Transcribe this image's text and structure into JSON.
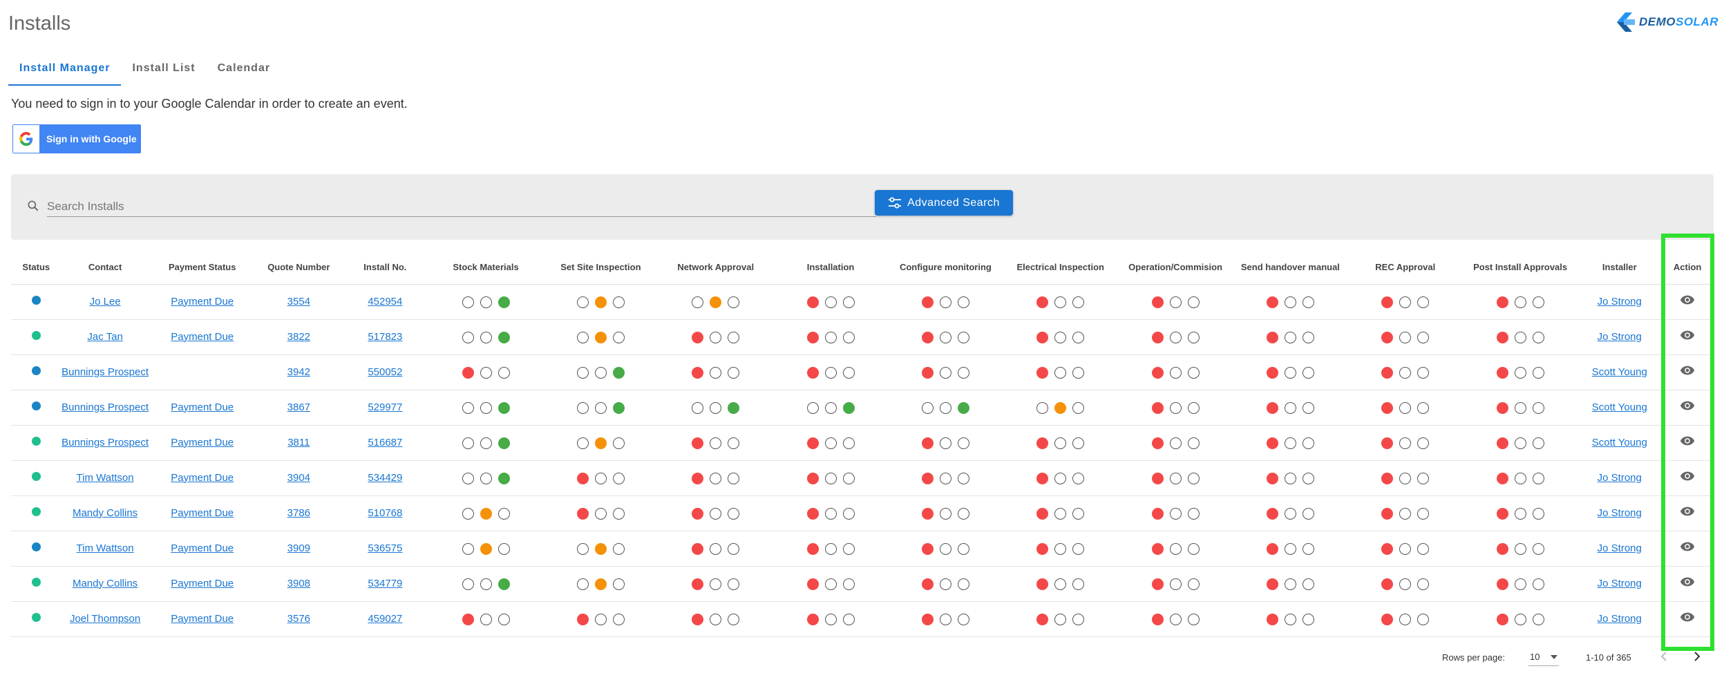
{
  "page": {
    "title": "Installs"
  },
  "logo": {
    "demo": "DEMO",
    "solar": "SOLAR"
  },
  "tabs": [
    {
      "label": "Install Manager",
      "active": true
    },
    {
      "label": "Install List",
      "active": false
    },
    {
      "label": "Calendar",
      "active": false
    }
  ],
  "gcal": {
    "message": "You need to sign in to your Google Calendar in order to create an event.",
    "button_label": "Sign in with Google"
  },
  "search": {
    "placeholder": "Search Installs",
    "advanced_label": "Advanced Search"
  },
  "table": {
    "headers": [
      "Status",
      "Contact",
      "Payment Status",
      "Quote Number",
      "Install No.",
      "Stock Materials",
      "Set Site Inspection",
      "Network Approval",
      "Installation",
      "Configure monitoring",
      "Electrical Inspection",
      "Operation/Commision",
      "Send handover manual",
      "REC Approval",
      "Post Install Approvals",
      "Installer",
      "Action"
    ],
    "status_colors": {
      "blue": "#1a85c4",
      "teal": "#1fbf8f"
    },
    "rows": [
      {
        "status": "blue",
        "contact": "Jo Lee",
        "payment": "Payment Due",
        "quote": "3554",
        "install_no": "452954",
        "stages": [
          [
            "o",
            "o",
            "g"
          ],
          [
            "o",
            "y",
            "o"
          ],
          [
            "o",
            "y",
            "o"
          ],
          [
            "r",
            "o",
            "o"
          ],
          [
            "r",
            "o",
            "o"
          ],
          [
            "r",
            "o",
            "o"
          ],
          [
            "r",
            "o",
            "o"
          ],
          [
            "r",
            "o",
            "o"
          ],
          [
            "r",
            "o",
            "o"
          ],
          [
            "r",
            "o",
            "o"
          ]
        ],
        "installer": "Jo Strong"
      },
      {
        "status": "teal",
        "contact": "Jac Tan",
        "payment": "Payment Due",
        "quote": "3822",
        "install_no": "517823",
        "stages": [
          [
            "o",
            "o",
            "g"
          ],
          [
            "o",
            "y",
            "o"
          ],
          [
            "r",
            "o",
            "o"
          ],
          [
            "r",
            "o",
            "o"
          ],
          [
            "r",
            "o",
            "o"
          ],
          [
            "r",
            "o",
            "o"
          ],
          [
            "r",
            "o",
            "o"
          ],
          [
            "r",
            "o",
            "o"
          ],
          [
            "r",
            "o",
            "o"
          ],
          [
            "r",
            "o",
            "o"
          ]
        ],
        "installer": "Jo Strong"
      },
      {
        "status": "blue",
        "contact": "Bunnings Prospect",
        "payment": "",
        "quote": "3942",
        "install_no": "550052",
        "stages": [
          [
            "r",
            "o",
            "o"
          ],
          [
            "o",
            "o",
            "g"
          ],
          [
            "r",
            "o",
            "o"
          ],
          [
            "r",
            "o",
            "o"
          ],
          [
            "r",
            "o",
            "o"
          ],
          [
            "r",
            "o",
            "o"
          ],
          [
            "r",
            "o",
            "o"
          ],
          [
            "r",
            "o",
            "o"
          ],
          [
            "r",
            "o",
            "o"
          ],
          [
            "r",
            "o",
            "o"
          ]
        ],
        "installer": "Scott Young"
      },
      {
        "status": "blue",
        "contact": "Bunnings Prospect",
        "payment": "Payment Due",
        "quote": "3867",
        "install_no": "529977",
        "stages": [
          [
            "o",
            "o",
            "g"
          ],
          [
            "o",
            "o",
            "g"
          ],
          [
            "o",
            "o",
            "g"
          ],
          [
            "o",
            "o",
            "g"
          ],
          [
            "o",
            "o",
            "g"
          ],
          [
            "o",
            "y",
            "o"
          ],
          [
            "r",
            "o",
            "o"
          ],
          [
            "r",
            "o",
            "o"
          ],
          [
            "r",
            "o",
            "o"
          ],
          [
            "r",
            "o",
            "o"
          ]
        ],
        "installer": "Scott Young"
      },
      {
        "status": "teal",
        "contact": "Bunnings Prospect",
        "payment": "Payment Due",
        "quote": "3811",
        "install_no": "516687",
        "stages": [
          [
            "o",
            "o",
            "g"
          ],
          [
            "o",
            "y",
            "o"
          ],
          [
            "r",
            "o",
            "o"
          ],
          [
            "r",
            "o",
            "o"
          ],
          [
            "r",
            "o",
            "o"
          ],
          [
            "r",
            "o",
            "o"
          ],
          [
            "r",
            "o",
            "o"
          ],
          [
            "r",
            "o",
            "o"
          ],
          [
            "r",
            "o",
            "o"
          ],
          [
            "r",
            "o",
            "o"
          ]
        ],
        "installer": "Scott Young"
      },
      {
        "status": "teal",
        "contact": "Tim Wattson",
        "payment": "Payment Due",
        "quote": "3904",
        "install_no": "534429",
        "stages": [
          [
            "o",
            "o",
            "g"
          ],
          [
            "r",
            "o",
            "o"
          ],
          [
            "r",
            "o",
            "o"
          ],
          [
            "r",
            "o",
            "o"
          ],
          [
            "r",
            "o",
            "o"
          ],
          [
            "r",
            "o",
            "o"
          ],
          [
            "r",
            "o",
            "o"
          ],
          [
            "r",
            "o",
            "o"
          ],
          [
            "r",
            "o",
            "o"
          ],
          [
            "r",
            "o",
            "o"
          ]
        ],
        "installer": "Jo Strong"
      },
      {
        "status": "teal",
        "contact": "Mandy Collins",
        "payment": "Payment Due",
        "quote": "3786",
        "install_no": "510768",
        "stages": [
          [
            "o",
            "y",
            "o"
          ],
          [
            "r",
            "o",
            "o"
          ],
          [
            "r",
            "o",
            "o"
          ],
          [
            "r",
            "o",
            "o"
          ],
          [
            "r",
            "o",
            "o"
          ],
          [
            "r",
            "o",
            "o"
          ],
          [
            "r",
            "o",
            "o"
          ],
          [
            "r",
            "o",
            "o"
          ],
          [
            "r",
            "o",
            "o"
          ],
          [
            "r",
            "o",
            "o"
          ]
        ],
        "installer": "Jo Strong"
      },
      {
        "status": "blue",
        "contact": "Tim Wattson",
        "payment": "Payment Due",
        "quote": "3909",
        "install_no": "536575",
        "stages": [
          [
            "o",
            "y",
            "o"
          ],
          [
            "o",
            "y",
            "o"
          ],
          [
            "r",
            "o",
            "o"
          ],
          [
            "r",
            "o",
            "o"
          ],
          [
            "r",
            "o",
            "o"
          ],
          [
            "r",
            "o",
            "o"
          ],
          [
            "r",
            "o",
            "o"
          ],
          [
            "r",
            "o",
            "o"
          ],
          [
            "r",
            "o",
            "o"
          ],
          [
            "r",
            "o",
            "o"
          ]
        ],
        "installer": "Jo Strong"
      },
      {
        "status": "teal",
        "contact": "Mandy Collins",
        "payment": "Payment Due",
        "quote": "3908",
        "install_no": "534779",
        "stages": [
          [
            "o",
            "o",
            "g"
          ],
          [
            "o",
            "y",
            "o"
          ],
          [
            "r",
            "o",
            "o"
          ],
          [
            "r",
            "o",
            "o"
          ],
          [
            "r",
            "o",
            "o"
          ],
          [
            "r",
            "o",
            "o"
          ],
          [
            "r",
            "o",
            "o"
          ],
          [
            "r",
            "o",
            "o"
          ],
          [
            "r",
            "o",
            "o"
          ],
          [
            "r",
            "o",
            "o"
          ]
        ],
        "installer": "Jo Strong"
      },
      {
        "status": "teal",
        "contact": "Joel Thompson",
        "payment": "Payment Due",
        "quote": "3576",
        "install_no": "459027",
        "stages": [
          [
            "r",
            "o",
            "o"
          ],
          [
            "r",
            "o",
            "o"
          ],
          [
            "r",
            "o",
            "o"
          ],
          [
            "r",
            "o",
            "o"
          ],
          [
            "r",
            "o",
            "o"
          ],
          [
            "r",
            "o",
            "o"
          ],
          [
            "r",
            "o",
            "o"
          ],
          [
            "r",
            "o",
            "o"
          ],
          [
            "r",
            "o",
            "o"
          ],
          [
            "r",
            "o",
            "o"
          ]
        ],
        "installer": "Jo Strong"
      }
    ]
  },
  "pagination": {
    "rows_per_page_label": "Rows per page:",
    "rows_per_page_value": "10",
    "range": "1-10 of 365"
  }
}
